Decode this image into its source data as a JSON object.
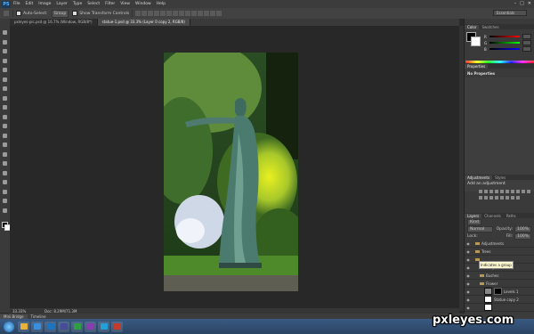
{
  "app": {
    "logo": "PS"
  },
  "menu": [
    "File",
    "Edit",
    "Image",
    "Layer",
    "Type",
    "Select",
    "Filter",
    "View",
    "Window",
    "Help"
  ],
  "window_controls": [
    "–",
    "□",
    "✕"
  ],
  "options": {
    "auto_select": "Auto-Select:",
    "auto_select_target": "Group",
    "transform_controls": "Show Transform Controls",
    "workspace": "Essentials"
  },
  "tabs": [
    {
      "label": "pxleyes-pic.psd @ 16.7% (Window, RGB/8*)",
      "active": false
    },
    {
      "label": "statue-1.psd @ 33.3% (Layer 0 copy 2, RGB/8)",
      "active": true
    }
  ],
  "status": {
    "zoom": "33.33%",
    "doc": "Doc: 8.29M/71.3M"
  },
  "bridge_tabs": [
    "Mini Bridge",
    "Timeline"
  ],
  "panels": {
    "color_tabs": [
      "Color",
      "Swatches"
    ],
    "color_channels": [
      {
        "label": "R",
        "gradient": "linear-gradient(to right,#000,#f00)"
      },
      {
        "label": "G",
        "gradient": "linear-gradient(to right,#000,#0f0)"
      },
      {
        "label": "B",
        "gradient": "linear-gradient(to right,#000,#00f)"
      }
    ],
    "properties_tab": "Properties",
    "properties_text": "No Properties",
    "adjustments_tabs": [
      "Adjustments",
      "Styles"
    ],
    "adjustments_title": "Add an adjustment",
    "layers_tabs": [
      "Layers",
      "Channels",
      "Paths"
    ],
    "layers_kind": "Kind",
    "blend_mode": "Normal",
    "opacity_label": "Opacity:",
    "opacity_value": "100%",
    "lock_label": "Lock:",
    "fill_label": "Fill:",
    "fill_value": "100%",
    "layers": [
      {
        "name": "Adjustments",
        "type": "folder",
        "indent": 0
      },
      {
        "name": "Trees",
        "type": "folder",
        "indent": 0
      },
      {
        "name": "",
        "type": "folder",
        "indent": 0
      },
      {
        "name": "Shapes",
        "type": "folder",
        "indent": 1
      },
      {
        "name": "Bushes",
        "type": "folder",
        "indent": 1
      },
      {
        "name": "Flower",
        "type": "folder",
        "indent": 1
      },
      {
        "name": "Levels 1",
        "type": "adjust",
        "indent": 2
      },
      {
        "name": "Statue copy 2",
        "type": "pixel",
        "indent": 2
      },
      {
        "name": "",
        "type": "pixel",
        "indent": 2
      }
    ],
    "tooltip": "Indicates a group"
  },
  "watermark": "pxleyes.com",
  "colors": {
    "taskbar_apps": [
      "#e8b23a",
      "#3a8ee0",
      "#1a74c4",
      "#4a4a9a",
      "#2ea043",
      "#8a3bb0",
      "#22a0d8",
      "#c43b2a"
    ]
  }
}
